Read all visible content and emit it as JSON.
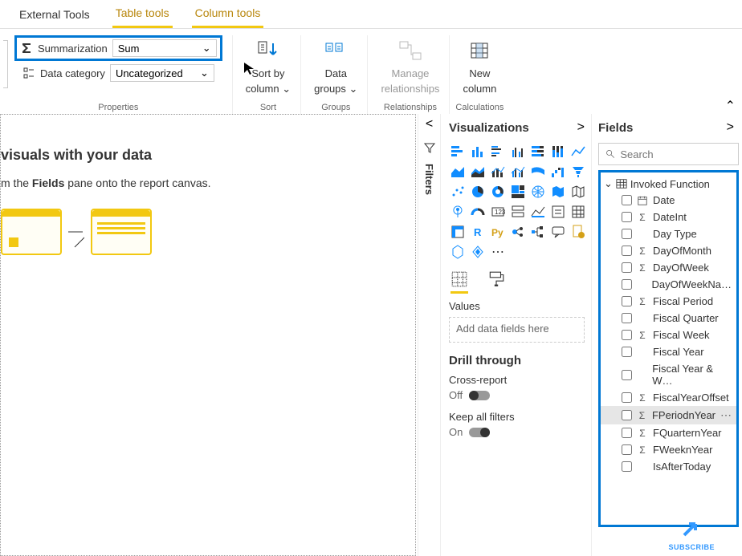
{
  "tabs": {
    "external": "External Tools",
    "table": "Table tools",
    "column": "Column tools"
  },
  "properties": {
    "summarization_label": "Summarization",
    "summarization_value": "Sum",
    "categories_label": "Data category",
    "categories_value": "Uncategorized",
    "group_label": "Properties"
  },
  "sort_group": {
    "line1": "Sort by",
    "line2": "column",
    "group_label": "Sort"
  },
  "data_groups": {
    "line1": "Data",
    "line2": "groups",
    "group_label": "Groups"
  },
  "relationships": {
    "line1": "Manage",
    "line2": "relationships",
    "group_label": "Relationships"
  },
  "calculations": {
    "line1": "New",
    "line2": "column",
    "group_label": "Calculations"
  },
  "canvas": {
    "title_partial": "visuals with your data",
    "hint_prefix": "m the ",
    "hint_bold": "Fields",
    "hint_suffix": " pane onto the report canvas."
  },
  "filters": {
    "label": "Filters"
  },
  "viz": {
    "header": "Visualizations",
    "values_label": "Values",
    "values_placeholder": "Add data fields here",
    "drill_header": "Drill through",
    "cross_report": "Cross-report",
    "off": "Off",
    "keep_filters": "Keep all filters",
    "on": "On"
  },
  "fields": {
    "header": "Fields",
    "search_placeholder": "Search",
    "table_name": "Invoked Function",
    "items": [
      {
        "name": "Date",
        "prefix": "cal"
      },
      {
        "name": "DateInt",
        "prefix": "Σ"
      },
      {
        "name": "Day Type",
        "prefix": ""
      },
      {
        "name": "DayOfMonth",
        "prefix": "Σ"
      },
      {
        "name": "DayOfWeek",
        "prefix": "Σ"
      },
      {
        "name": "DayOfWeekNa…",
        "prefix": ""
      },
      {
        "name": "Fiscal Period",
        "prefix": "Σ"
      },
      {
        "name": "Fiscal Quarter",
        "prefix": ""
      },
      {
        "name": "Fiscal Week",
        "prefix": "Σ"
      },
      {
        "name": "Fiscal Year",
        "prefix": ""
      },
      {
        "name": "Fiscal Year & W…",
        "prefix": ""
      },
      {
        "name": "FiscalYearOffset",
        "prefix": "Σ"
      },
      {
        "name": "FPeriodnYear",
        "prefix": "Σ",
        "selected": true
      },
      {
        "name": "FQuarternYear",
        "prefix": "Σ"
      },
      {
        "name": "FWeeknYear",
        "prefix": "Σ"
      },
      {
        "name": "IsAfterToday",
        "prefix": ""
      }
    ]
  },
  "subscribe": "SUBSCRIBE"
}
